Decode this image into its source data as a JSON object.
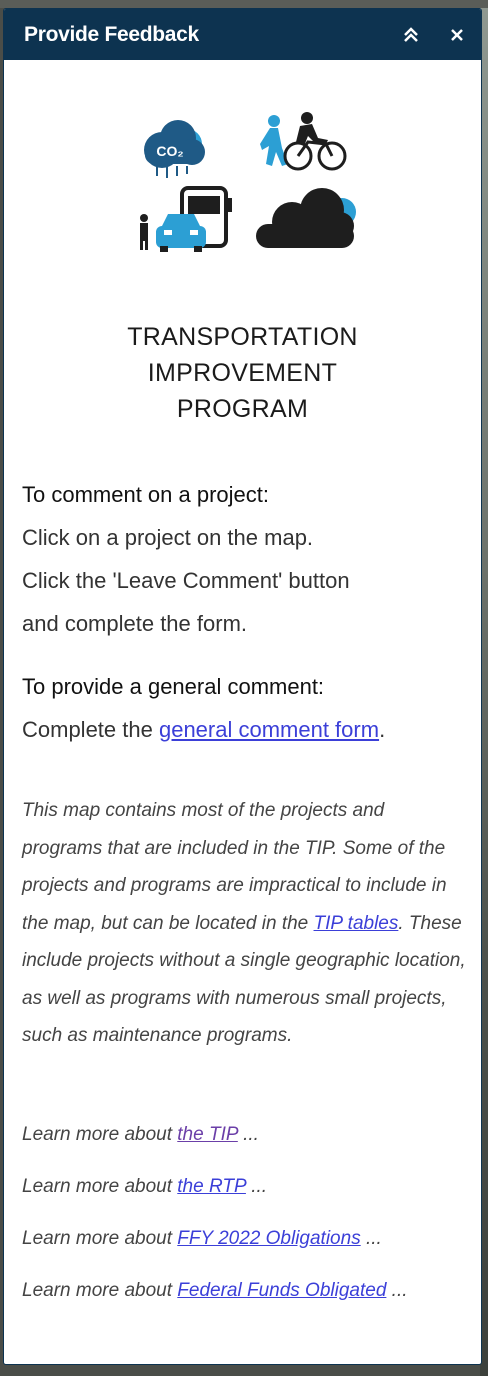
{
  "panel": {
    "title": "Provide Feedback",
    "collapse_icon": "double-chevron-up-icon",
    "close_icon": "close-icon",
    "header_color": "#0d3350"
  },
  "logo": {
    "icons": [
      "co2-cloud-icon",
      "pedestrian-cyclist-icon",
      "bus-car-icon",
      "cloud-icon"
    ],
    "co2_text": "CO₂",
    "title_lines": [
      "TRANSPORTATION",
      "IMPROVEMENT",
      "PROGRAM"
    ],
    "colors": {
      "blue": "#1f5a86",
      "light_blue": "#2c9fd4",
      "dark": "#1e1e1e"
    }
  },
  "comment_project": {
    "heading": "To comment on a project:",
    "lines": [
      "Click on a project on the map.",
      "Click the 'Leave Comment' button",
      "and complete the form."
    ]
  },
  "general_comment": {
    "heading": "To provide a general comment:",
    "prefix": "Complete the ",
    "link": "general comment form",
    "suffix": "."
  },
  "disclaimer": {
    "part1": "This map contains most of the projects and programs that are included in the TIP. Some of the projects and programs are impractical to include in the map, but can be located in the ",
    "link": "TIP tables",
    "part2": ". These include projects without a single geographic location, as well as programs with numerous small projects, such as maintenance programs."
  },
  "learn_more": [
    {
      "prefix": "Learn more about ",
      "link": "the TIP",
      "suffix": " ..."
    },
    {
      "prefix": "Learn more about ",
      "link": "the RTP",
      "suffix": " ..."
    },
    {
      "prefix": "Learn more about ",
      "link": "FFY 2022 Obligations",
      "suffix": " ..."
    },
    {
      "prefix": "Learn more about ",
      "link": "Federal Funds Obligated",
      "suffix": " ..."
    }
  ]
}
